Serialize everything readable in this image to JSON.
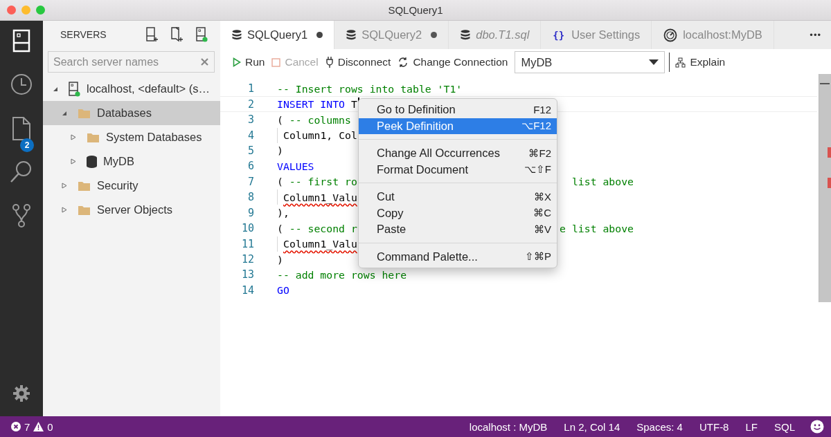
{
  "window": {
    "title": "SQLQuery1"
  },
  "activity_bar": {
    "items": [
      {
        "kind": "servers",
        "selected": true
      },
      {
        "kind": "history",
        "selected": false
      },
      {
        "kind": "files",
        "selected": false,
        "badge": "2"
      },
      {
        "kind": "search",
        "selected": false
      },
      {
        "kind": "source",
        "selected": false
      }
    ],
    "bottom": [
      {
        "kind": "settings"
      }
    ]
  },
  "sidebar": {
    "title": "SERVERS",
    "search": {
      "placeholder": "Search server names"
    },
    "tree": [
      {
        "label": "localhost, <default> (s…",
        "kind": "server",
        "expanded": true,
        "selected": false,
        "children": [
          {
            "label": "Databases",
            "kind": "folder",
            "expanded": true,
            "selected": true,
            "children": [
              {
                "label": "System Databases",
                "kind": "folder",
                "expanded": false,
                "selected": false
              },
              {
                "label": "MyDB",
                "kind": "database",
                "expanded": false,
                "selected": false
              }
            ]
          },
          {
            "label": "Security",
            "kind": "folder",
            "expanded": false,
            "selected": false
          },
          {
            "label": "Server Objects",
            "kind": "folder",
            "expanded": false,
            "selected": false
          }
        ]
      }
    ]
  },
  "tabs": [
    {
      "label": "SQLQuery1",
      "kind": "query",
      "selected": true,
      "dirty": true,
      "preview": false
    },
    {
      "label": "SQLQuery2",
      "kind": "query",
      "selected": false,
      "dirty": true,
      "preview": false
    },
    {
      "label": "dbo.T1.sql",
      "kind": "query",
      "selected": false,
      "dirty": false,
      "preview": true
    },
    {
      "label": "User Settings",
      "kind": "settings",
      "glyph": "{}",
      "selected": false,
      "dirty": false,
      "preview": false
    },
    {
      "label": "localhost:MyDB",
      "kind": "dashboard",
      "selected": false,
      "dirty": false,
      "preview": false
    }
  ],
  "tabs_more": "•••",
  "toolbar": [
    {
      "kind": "run",
      "label": "Run",
      "disabled": false
    },
    {
      "kind": "cancel",
      "label": "Cancel",
      "disabled": true
    },
    {
      "kind": "disconnect",
      "label": "Disconnect",
      "disabled": false
    },
    {
      "kind": "change",
      "label": "Change Connection",
      "disabled": false
    },
    {
      "kind": "select",
      "value": "MyDB"
    },
    {
      "kind": "explain",
      "label": "Explain",
      "disabled": false
    }
  ],
  "code": [
    {
      "n": "1",
      "segments": [
        {
          "kind": "comment",
          "text": "-- Insert rows into table 'T1'"
        }
      ]
    },
    {
      "n": "2",
      "current": true,
      "segments": [
        {
          "kind": "keyword",
          "text": "INSERT INTO"
        },
        {
          "kind": "plain",
          "text": " T"
        }
      ]
    },
    {
      "n": "3",
      "segments": [
        {
          "kind": "plain",
          "text": "( "
        },
        {
          "kind": "comment",
          "text": "-- columns"
        }
      ]
    },
    {
      "n": "4",
      "indented": true,
      "segments": [
        {
          "kind": "plain",
          "text": "Column1, Col"
        }
      ]
    },
    {
      "n": "5",
      "segments": [
        {
          "kind": "plain",
          "text": ")"
        }
      ]
    },
    {
      "n": "6",
      "segments": [
        {
          "kind": "keyword",
          "text": "VALUES"
        }
      ]
    },
    {
      "n": "7",
      "segments": [
        {
          "kind": "plain",
          "text": "( "
        },
        {
          "kind": "comment",
          "text": "-- first ro"
        }
      ],
      "tail": "list above"
    },
    {
      "n": "8",
      "indented": true,
      "segments": [
        {
          "kind": "error",
          "text": "Column1_Valu"
        }
      ]
    },
    {
      "n": "9",
      "segments": [
        {
          "kind": "plain",
          "text": "),"
        }
      ]
    },
    {
      "n": "10",
      "segments": [
        {
          "kind": "plain",
          "text": "( "
        },
        {
          "kind": "comment",
          "text": "-- second r"
        }
      ],
      "tail": "e list above"
    },
    {
      "n": "11",
      "indented": true,
      "segments": [
        {
          "kind": "error",
          "text": "Column1_Valu"
        }
      ]
    },
    {
      "n": "12",
      "segments": [
        {
          "kind": "plain",
          "text": ")"
        }
      ]
    },
    {
      "n": "13",
      "segments": [
        {
          "kind": "comment",
          "text": "-- add more rows here"
        }
      ]
    },
    {
      "n": "14",
      "segments": [
        {
          "kind": "keyword",
          "text": "GO"
        }
      ]
    }
  ],
  "context_menu": [
    [
      {
        "label": "Go to Definition",
        "shortcut": "F12",
        "selected": false
      },
      {
        "label": "Peek Definition",
        "shortcut": "⌥F12",
        "selected": true
      }
    ],
    [
      {
        "label": "Change All Occurrences",
        "shortcut": "⌘F2",
        "selected": false
      },
      {
        "label": "Format Document",
        "shortcut": "⌥⇧F",
        "selected": false
      }
    ],
    [
      {
        "label": "Cut",
        "shortcut": "⌘X",
        "selected": false
      },
      {
        "label": "Copy",
        "shortcut": "⌘C",
        "selected": false
      },
      {
        "label": "Paste",
        "shortcut": "⌘V",
        "selected": false
      }
    ],
    [
      {
        "label": "Command Palette...",
        "shortcut": "⇧⌘P",
        "selected": false
      }
    ]
  ],
  "status_bar": {
    "errors": "7",
    "warnings": "0",
    "items": [
      "localhost : MyDB",
      "Ln 2, Col 14",
      "Spaces: 4",
      "UTF-8",
      "LF",
      "SQL"
    ]
  }
}
